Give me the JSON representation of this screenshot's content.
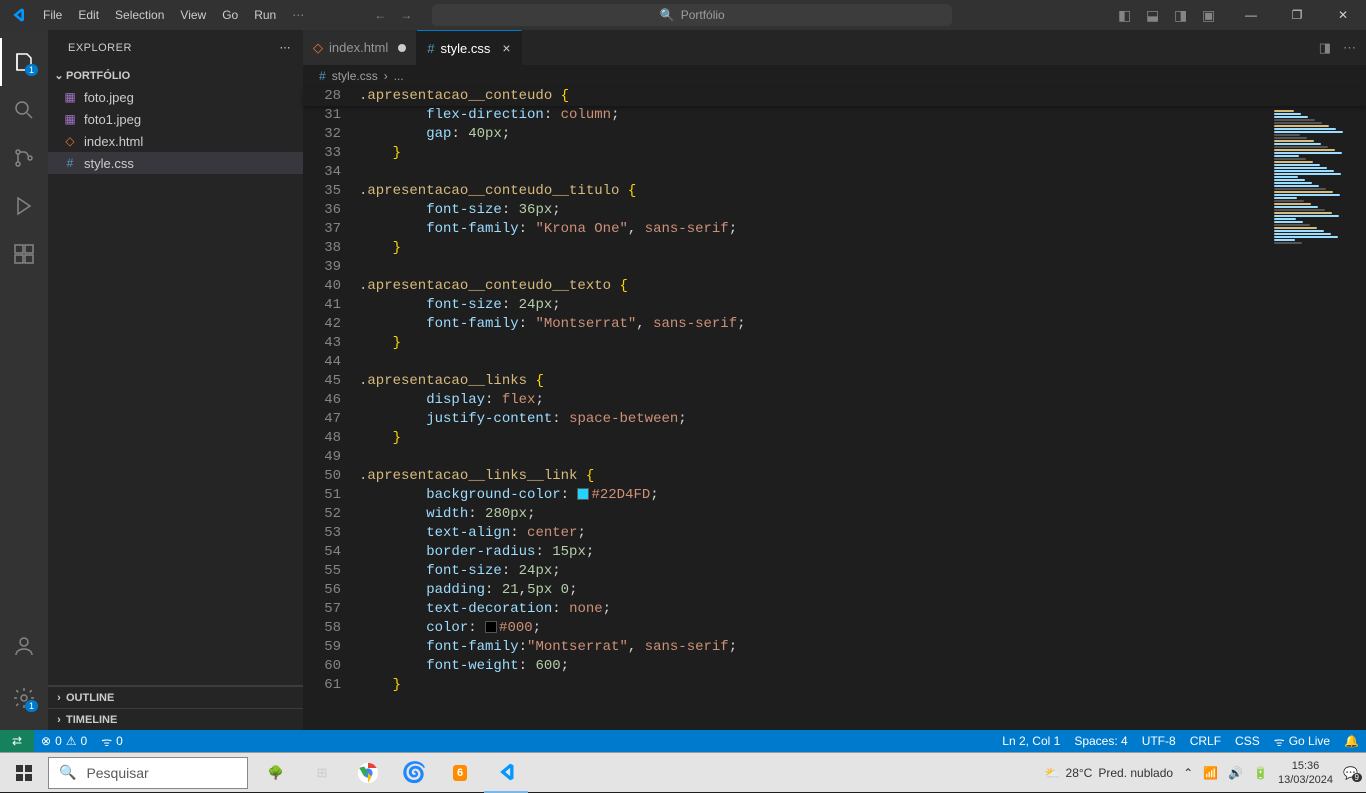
{
  "titlebar": {
    "menu": [
      "File",
      "Edit",
      "Selection",
      "View",
      "Go",
      "Run"
    ],
    "search_text": "Portfólio"
  },
  "sidebar": {
    "title": "EXPLORER",
    "project": "PORTFÓLIO",
    "files": [
      {
        "name": "foto.jpeg",
        "icon": "image",
        "color": "#a074c4"
      },
      {
        "name": "foto1.jpeg",
        "icon": "image",
        "color": "#a074c4"
      },
      {
        "name": "index.html",
        "icon": "html",
        "color": "#e37933"
      },
      {
        "name": "style.css",
        "icon": "css",
        "color": "#519aba",
        "selected": true
      }
    ],
    "outline": "OUTLINE",
    "timeline": "TIMELINE"
  },
  "tabs": [
    {
      "name": "index.html",
      "icon": "◇",
      "icon_color": "#e37933",
      "dirty": true,
      "active": false
    },
    {
      "name": "style.css",
      "icon": "#",
      "icon_color": "#519aba",
      "dirty": false,
      "active": true
    }
  ],
  "breadcrumb": {
    "file": "style.css",
    "rest": "..."
  },
  "sticky": {
    "num": "28",
    "selector": ".apresentacao__conteudo"
  },
  "code": [
    {
      "n": 31,
      "indent": 2,
      "segs": [
        [
          "prop",
          "flex-direction"
        ],
        [
          "punc",
          ": "
        ],
        [
          "val",
          "column"
        ],
        [
          "punc",
          ";"
        ]
      ]
    },
    {
      "n": 32,
      "indent": 2,
      "segs": [
        [
          "prop",
          "gap"
        ],
        [
          "punc",
          ": "
        ],
        [
          "num",
          "40px"
        ],
        [
          "punc",
          ";"
        ]
      ]
    },
    {
      "n": 33,
      "indent": 1,
      "segs": [
        [
          "brace",
          "}"
        ]
      ]
    },
    {
      "n": 34,
      "indent": 0,
      "segs": []
    },
    {
      "n": 35,
      "indent": 0,
      "segs": [
        [
          "sel",
          ".apresentacao__conteudo__titulo "
        ],
        [
          "brace",
          "{"
        ]
      ]
    },
    {
      "n": 36,
      "indent": 2,
      "segs": [
        [
          "prop",
          "font-size"
        ],
        [
          "punc",
          ": "
        ],
        [
          "num",
          "36px"
        ],
        [
          "punc",
          ";"
        ]
      ]
    },
    {
      "n": 37,
      "indent": 2,
      "segs": [
        [
          "prop",
          "font-family"
        ],
        [
          "punc",
          ": "
        ],
        [
          "val",
          "\"Krona One\""
        ],
        [
          "punc",
          ", "
        ],
        [
          "val",
          "sans-serif"
        ],
        [
          "punc",
          ";"
        ]
      ]
    },
    {
      "n": 38,
      "indent": 1,
      "segs": [
        [
          "brace",
          "}"
        ]
      ]
    },
    {
      "n": 39,
      "indent": 0,
      "segs": []
    },
    {
      "n": 40,
      "indent": 0,
      "segs": [
        [
          "sel",
          ".apresentacao__conteudo__texto "
        ],
        [
          "brace",
          "{"
        ]
      ]
    },
    {
      "n": 41,
      "indent": 2,
      "segs": [
        [
          "prop",
          "font-size"
        ],
        [
          "punc",
          ": "
        ],
        [
          "num",
          "24px"
        ],
        [
          "punc",
          ";"
        ]
      ]
    },
    {
      "n": 42,
      "indent": 2,
      "segs": [
        [
          "prop",
          "font-family"
        ],
        [
          "punc",
          ": "
        ],
        [
          "val",
          "\"Montserrat\""
        ],
        [
          "punc",
          ", "
        ],
        [
          "val",
          "sans-serif"
        ],
        [
          "punc",
          ";"
        ]
      ]
    },
    {
      "n": 43,
      "indent": 1,
      "segs": [
        [
          "brace",
          "}"
        ]
      ]
    },
    {
      "n": 44,
      "indent": 0,
      "segs": []
    },
    {
      "n": 45,
      "indent": 0,
      "segs": [
        [
          "sel",
          ".apresentacao__links "
        ],
        [
          "brace",
          "{"
        ]
      ]
    },
    {
      "n": 46,
      "indent": 2,
      "segs": [
        [
          "prop",
          "display"
        ],
        [
          "punc",
          ": "
        ],
        [
          "val",
          "flex"
        ],
        [
          "punc",
          ";"
        ]
      ]
    },
    {
      "n": 47,
      "indent": 2,
      "segs": [
        [
          "prop",
          "justify-content"
        ],
        [
          "punc",
          ": "
        ],
        [
          "val",
          "space-between"
        ],
        [
          "punc",
          ";"
        ]
      ]
    },
    {
      "n": 48,
      "indent": 1,
      "segs": [
        [
          "brace",
          "}"
        ]
      ]
    },
    {
      "n": 49,
      "indent": 0,
      "segs": []
    },
    {
      "n": 50,
      "indent": 0,
      "segs": [
        [
          "sel",
          ".apresentacao__links__link "
        ],
        [
          "brace",
          "{"
        ]
      ]
    },
    {
      "n": 51,
      "indent": 2,
      "segs": [
        [
          "prop",
          "background-color"
        ],
        [
          "punc",
          ": "
        ],
        [
          "swatch",
          "#22D4FD"
        ],
        [
          "val",
          "#22D4FD"
        ],
        [
          "punc",
          ";"
        ]
      ]
    },
    {
      "n": 52,
      "indent": 2,
      "segs": [
        [
          "prop",
          "width"
        ],
        [
          "punc",
          ": "
        ],
        [
          "num",
          "280px"
        ],
        [
          "punc",
          ";"
        ]
      ]
    },
    {
      "n": 53,
      "indent": 2,
      "segs": [
        [
          "prop",
          "text-align"
        ],
        [
          "punc",
          ": "
        ],
        [
          "val",
          "center"
        ],
        [
          "punc",
          ";"
        ]
      ]
    },
    {
      "n": 54,
      "indent": 2,
      "segs": [
        [
          "prop",
          "border-radius"
        ],
        [
          "punc",
          ": "
        ],
        [
          "num",
          "15px"
        ],
        [
          "punc",
          ";"
        ]
      ]
    },
    {
      "n": 55,
      "indent": 2,
      "segs": [
        [
          "prop",
          "font-size"
        ],
        [
          "punc",
          ": "
        ],
        [
          "num",
          "24px"
        ],
        [
          "punc",
          ";"
        ]
      ]
    },
    {
      "n": 56,
      "indent": 2,
      "segs": [
        [
          "prop",
          "padding"
        ],
        [
          "punc",
          ": "
        ],
        [
          "num",
          "21"
        ],
        [
          "punc",
          ","
        ],
        [
          "num",
          "5px 0"
        ],
        [
          "punc",
          ";"
        ]
      ]
    },
    {
      "n": 57,
      "indent": 2,
      "segs": [
        [
          "prop",
          "text-decoration"
        ],
        [
          "punc",
          ": "
        ],
        [
          "val",
          "none"
        ],
        [
          "punc",
          ";"
        ]
      ]
    },
    {
      "n": 58,
      "indent": 2,
      "segs": [
        [
          "prop",
          "color"
        ],
        [
          "punc",
          ": "
        ],
        [
          "swatch",
          "#000"
        ],
        [
          "val",
          "#000"
        ],
        [
          "punc",
          ";"
        ]
      ]
    },
    {
      "n": 59,
      "indent": 2,
      "segs": [
        [
          "prop",
          "font-family"
        ],
        [
          "punc",
          ":"
        ],
        [
          "val",
          "\"Montserrat\""
        ],
        [
          "punc",
          ", "
        ],
        [
          "val",
          "sans-serif"
        ],
        [
          "punc",
          ";"
        ]
      ]
    },
    {
      "n": 60,
      "indent": 2,
      "segs": [
        [
          "prop",
          "font-weight"
        ],
        [
          "punc",
          ": "
        ],
        [
          "num",
          "600"
        ],
        [
          "punc",
          ";"
        ]
      ]
    },
    {
      "n": 61,
      "indent": 1,
      "segs": [
        [
          "brace",
          "}"
        ]
      ]
    }
  ],
  "statusbar": {
    "errors": "0",
    "warnings": "0",
    "ports": "0",
    "cursor": "Ln 2, Col 1",
    "spaces": "Spaces: 4",
    "encoding": "UTF-8",
    "eol": "CRLF",
    "lang": "CSS",
    "golive": "Go Live"
  },
  "taskbar": {
    "search_placeholder": "Pesquisar",
    "weather_temp": "28°C",
    "weather_desc": "Pred. nublado",
    "time": "15:36",
    "date": "13/03/2024",
    "notif": "9"
  },
  "activitybar": {
    "explorer_badge": "1",
    "settings_badge": "1"
  }
}
